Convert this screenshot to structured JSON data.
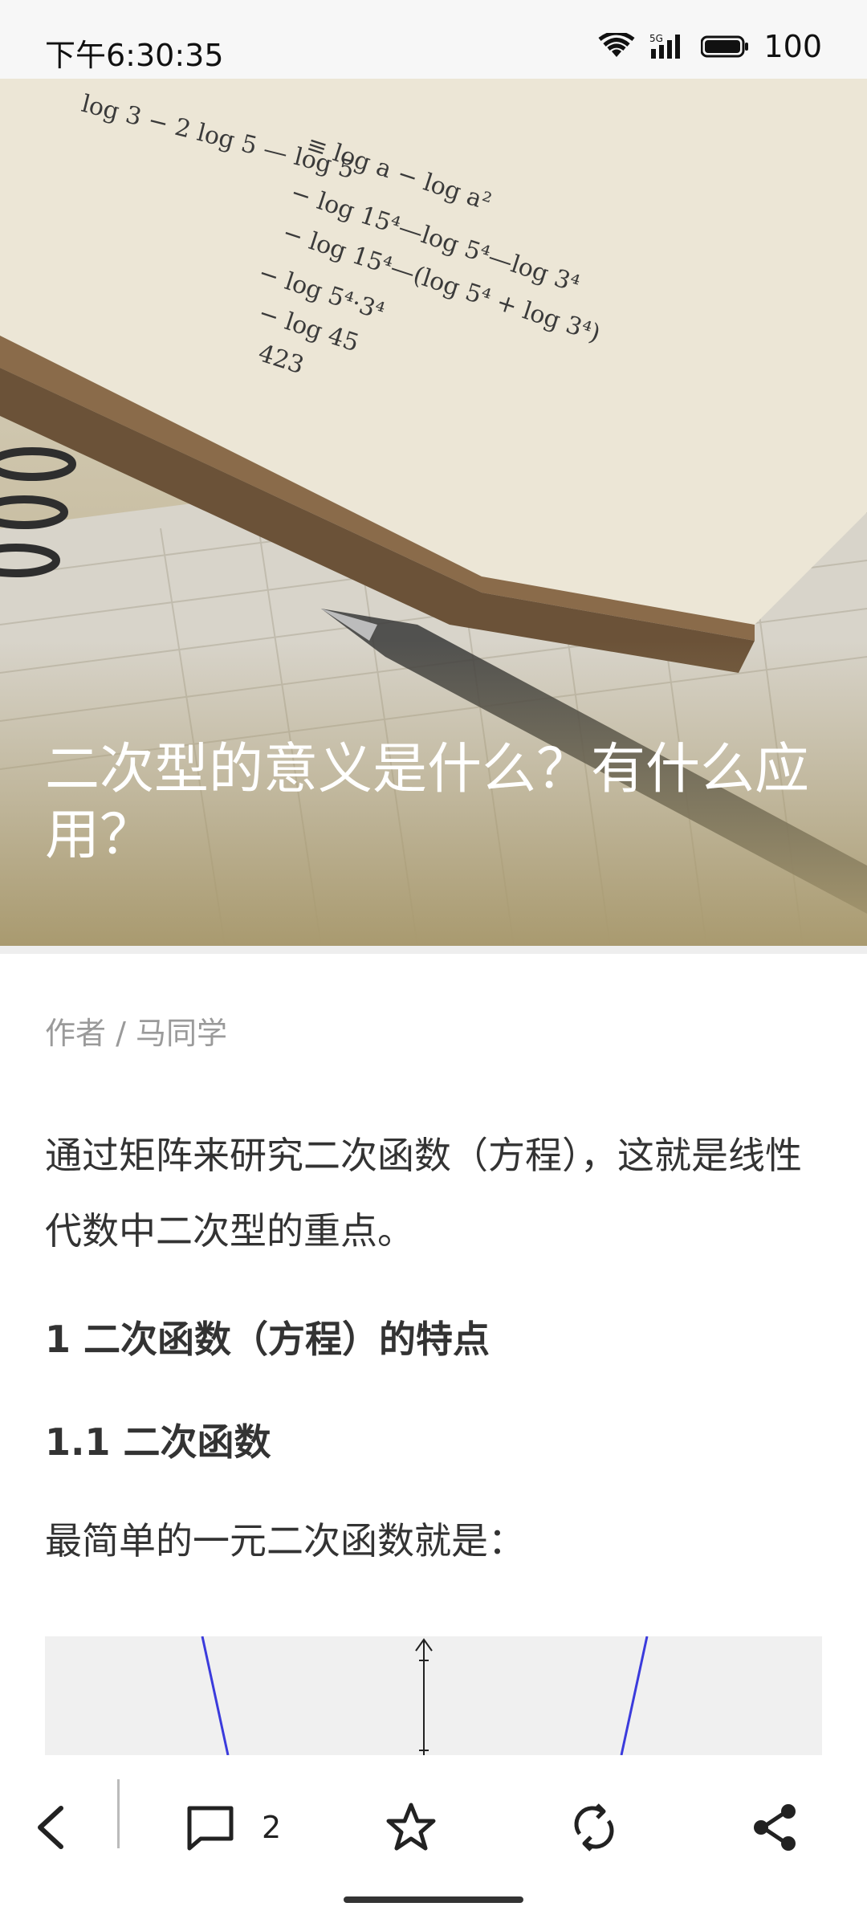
{
  "status": {
    "time": "下午6:30:35",
    "battery": "100",
    "icons": [
      "wifi-icon",
      "5g-signal-icon",
      "battery-icon"
    ]
  },
  "article": {
    "title": "二次型的意义是什么？有什么应用？",
    "author": "作者 / 马同学",
    "paragraph1": "通过矩阵来研究二次函数（方程），这就是线性代数中二次型的重点。",
    "heading1": "1 二次函数（方程）的特点",
    "heading2": "1.1 二次函数",
    "paragraph2": "最简单的一元二次函数就是："
  },
  "toolbar": {
    "comment_count": "2",
    "icons": [
      "back-icon",
      "comment-icon",
      "star-icon",
      "refresh-icon",
      "share-icon"
    ]
  },
  "colors": {
    "hero_overlay": "#a99a6f",
    "text": "#333333",
    "muted": "#9a9a9a",
    "curve": "#3b3bdc"
  }
}
